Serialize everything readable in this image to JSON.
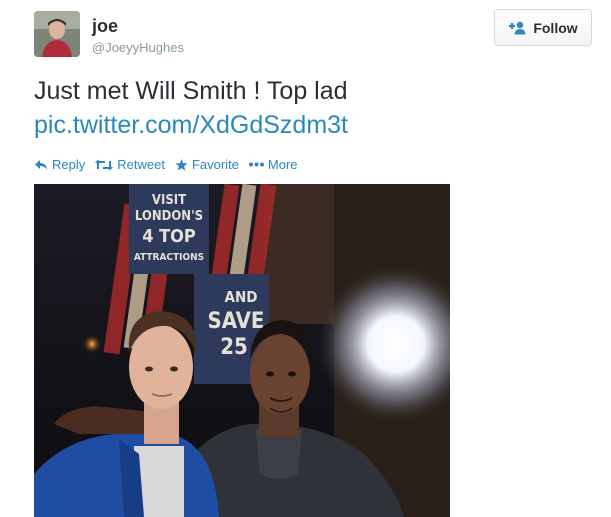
{
  "user": {
    "display_name": "joe",
    "handle": "@JoeyyHughes"
  },
  "follow_button": {
    "label": "Follow",
    "icon": "add-user-icon"
  },
  "tweet": {
    "text": "Just met Will Smith ! Top lad",
    "link": "pic.twitter.com/XdGdSzdm3t"
  },
  "actions": [
    {
      "label": "Reply",
      "icon": "reply-icon"
    },
    {
      "label": "Retweet",
      "icon": "retweet-icon"
    },
    {
      "label": "Favorite",
      "icon": "star-icon"
    },
    {
      "label": "More",
      "icon": "more-icon"
    }
  ],
  "photo": {
    "sign_lines": [
      "VISIT",
      "LONDON'S",
      "4 TOP",
      "ATTRACTIONS",
      "AND",
      "SAVE",
      "25"
    ]
  },
  "colors": {
    "link": "#2a88bd",
    "text": "#292f33",
    "muted": "#8899a6"
  }
}
